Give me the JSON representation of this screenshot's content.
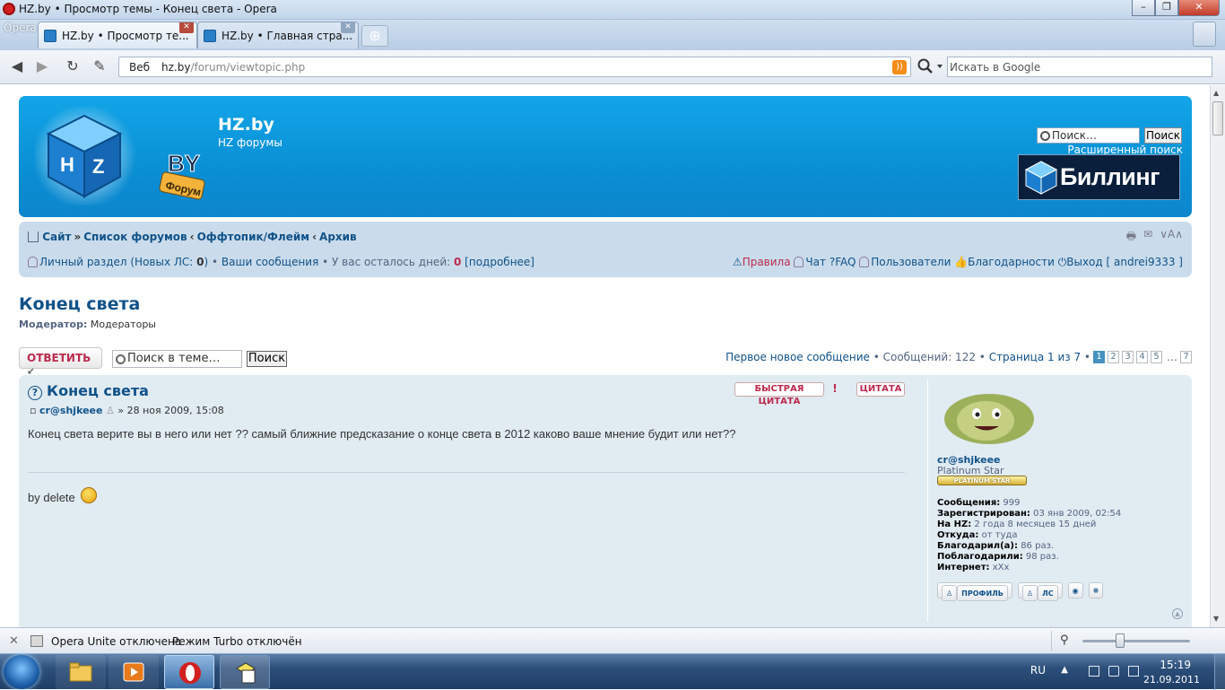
{
  "window": {
    "title": "HZ.by • Просмотр темы - Конец света - Opera",
    "buttons": {
      "minimize": "–",
      "maximize": "❐",
      "close": "✕"
    }
  },
  "tabs": [
    {
      "label": "HZ.by • Просмотр те..."
    },
    {
      "label": "HZ.by • Главная стра..."
    }
  ],
  "toolbar": {
    "opera_menu": "Opera",
    "address_prefix": "Веб",
    "url_host": "hz.by",
    "url_path": "/forum/viewtopic.php",
    "search_placeholder": "Искать в Google"
  },
  "header": {
    "site_name": "HZ.by",
    "site_desc": "HZ форумы",
    "search_placeholder": "Поиск…",
    "search_button": "Поиск",
    "advanced_search": "Расширенный поиск",
    "billing_label": "Биллинг",
    "logo_text": "BY",
    "logo_tag": "Форум"
  },
  "navbar": {
    "crumbs": [
      "Сайт",
      "Список форумов",
      "Оффтопик/Флейм",
      "Архив"
    ],
    "crumb_seps": [
      "»",
      "‹",
      "‹"
    ],
    "private": "Личный раздел (Новых ЛС: ",
    "private_count": "0",
    "private_end": ")",
    "your_posts": "Ваши сообщения",
    "days_left_label": "У вас осталось дней: ",
    "days_left": "0",
    "more": "[подробнее]",
    "rules": "Правила",
    "chat": "Чат",
    "faq": "FAQ",
    "users": "Пользователи",
    "thanks": "Благодарности",
    "logout": "Выход [ andrei9333 ]",
    "font_size": "A"
  },
  "topic": {
    "title": "Конец света",
    "moderator_label": "Модератор:",
    "moderator_value": "Модераторы"
  },
  "actions": {
    "reply": "ОТВЕТИТЬ",
    "search_placeholder": "Поиск в теме…",
    "search_button": "Поиск",
    "first_new": "Первое новое сообщение",
    "posts_count": "Сообщений: 122",
    "page_info": "Страница 1 из 7",
    "pages": [
      "1",
      "2",
      "3",
      "4",
      "5"
    ],
    "ellipsis": "…",
    "last_page": "7"
  },
  "post": {
    "title": "Конец света",
    "quick_quote": "БЫСТРАЯ ЦИТАТА",
    "quote": "ЦИТАТА",
    "author": "cr@shjkeee",
    "date": "» 28 ноя 2009, 15:08",
    "text": "Конец света верите вы в него или нет ?? самый ближние предсказание о конце света в 2012 каково ваше мнение будит или нет??",
    "signature": "by delete"
  },
  "profile": {
    "name": "cr@shjkeee",
    "rank": "Platinum Star",
    "rank_badge": "PLATINUM STAR",
    "stats": [
      {
        "label": "Сообщения:",
        "value": "999"
      },
      {
        "label": "Зарегистрирован:",
        "value": "03 янв 2009, 02:54"
      },
      {
        "label": "На HZ:",
        "value": "2 года 8 месяцев 15 дней"
      },
      {
        "label": "Откуда:",
        "value": "от туда"
      },
      {
        "label": "Благодарил(а):",
        "value": "86 раз."
      },
      {
        "label": "Поблагодарили:",
        "value": "98 раз."
      },
      {
        "label": "Интернет:",
        "value": "xXx"
      }
    ],
    "btn_profile": "ПРОФИЛЬ",
    "btn_pm": "ЛС"
  },
  "statusbar": {
    "unite": "Opera Unite отключена",
    "turbo": "Режим Turbo отключён"
  },
  "taskbar": {
    "lang": "RU",
    "time": "15:19",
    "date": "21.09.2011"
  },
  "colors": {
    "link": "#105289",
    "header_bg": "#0a8fd4",
    "accent_red": "#bc2a4d",
    "post_bg": "#e1ebf2"
  }
}
